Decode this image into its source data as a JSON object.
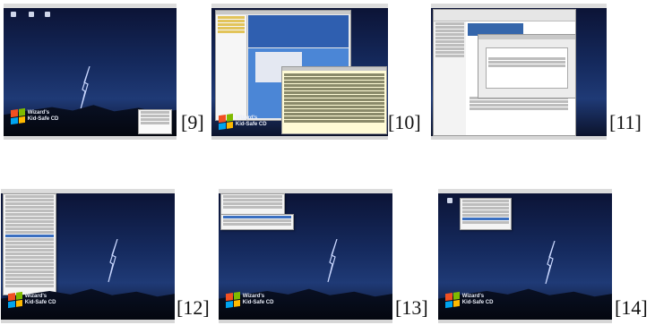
{
  "captions": [
    "[9]",
    "[10]",
    "[11]",
    "[12]",
    "[13]",
    "[14]"
  ],
  "brand": {
    "line1": "Wizard's",
    "line2": "Kid-Safe CD"
  },
  "thumbnails": [
    {
      "caption": "[9]",
      "content": "desktop with desktop icons and a system info dialog"
    },
    {
      "caption": "[10]",
      "content": "file manager and terminal windows"
    },
    {
      "caption": "[11]",
      "content": "web browser with a dialog"
    },
    {
      "caption": "[12]",
      "content": "desktop with long applications menu"
    },
    {
      "caption": "[13]",
      "content": "desktop with short applications menu"
    },
    {
      "caption": "[14]",
      "content": "desktop with submenu"
    }
  ],
  "colors": {
    "sky_top": "#0b1233",
    "sky_mid": "#1f3a76",
    "menu_highlight": "#3a6fc1",
    "terminal_bg": "#fffbd6"
  }
}
